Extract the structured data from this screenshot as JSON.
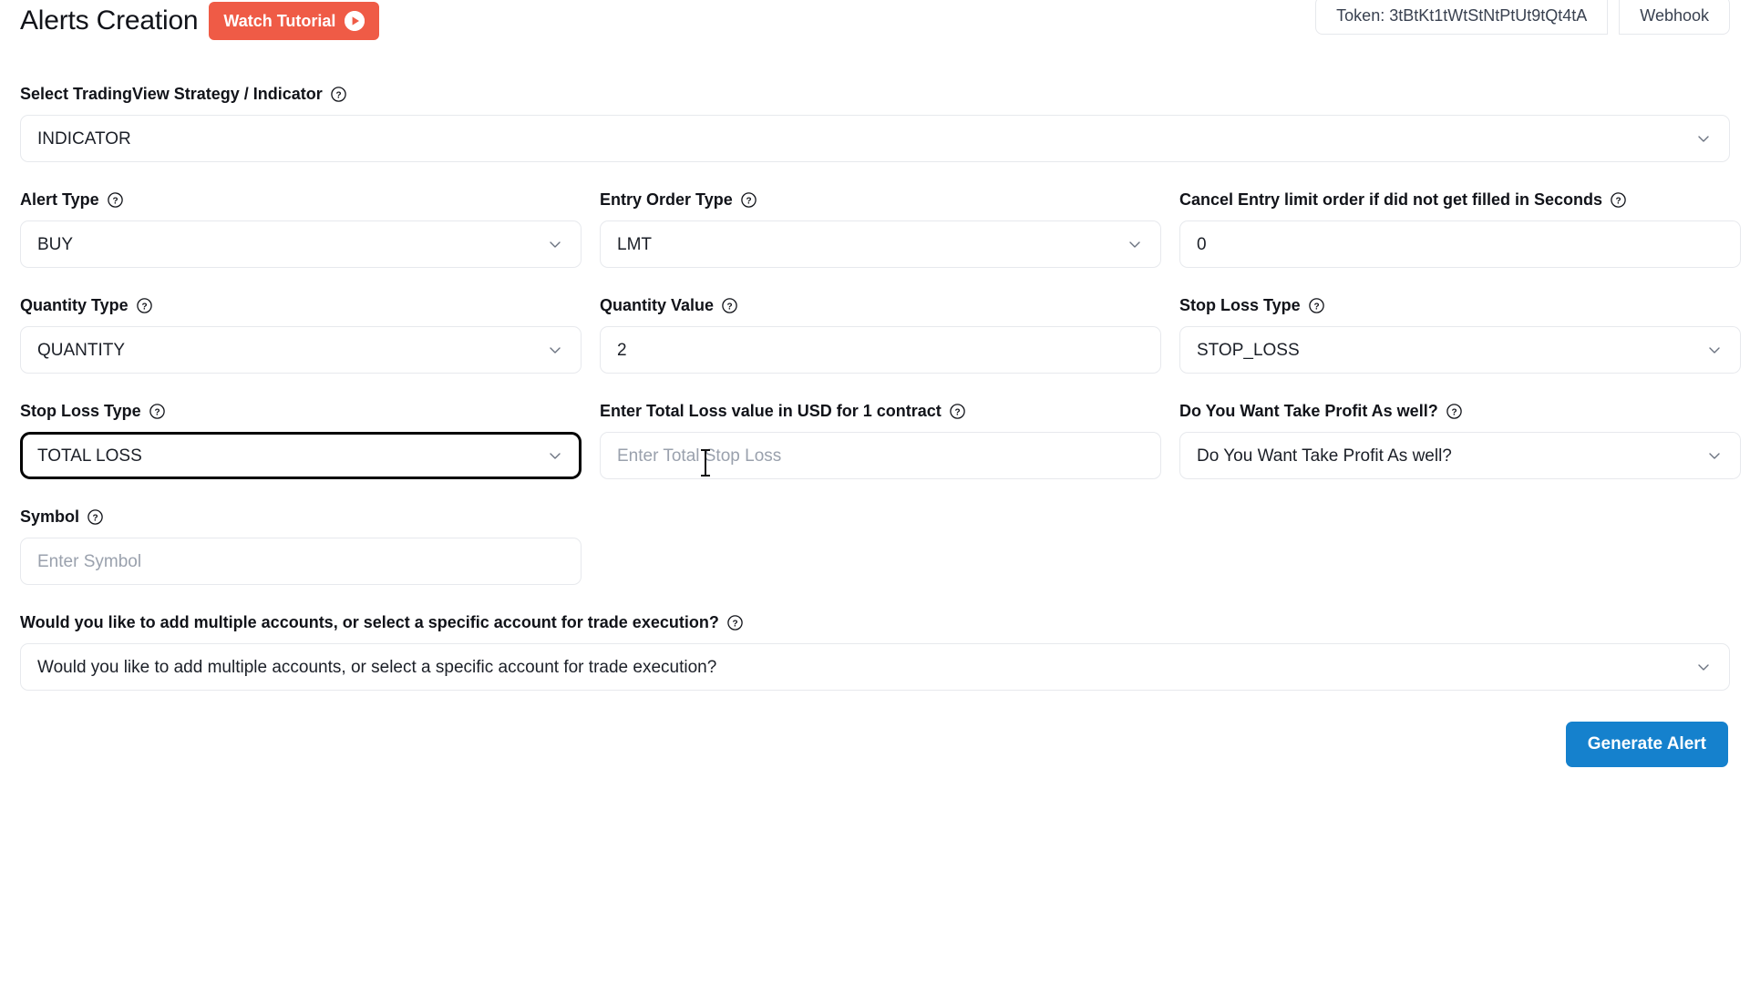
{
  "header": {
    "title": "Alerts Creation",
    "watch_tutorial_label": "Watch Tutorial",
    "token_label": "Token: 3tBtKt1tWtStNtPtUt9tQt4tA",
    "webhook_label": "Webhook"
  },
  "form": {
    "strategy": {
      "label": "Select TradingView Strategy / Indicator",
      "value": "INDICATOR"
    },
    "alert_type": {
      "label": "Alert Type",
      "value": "BUY"
    },
    "entry_order_type": {
      "label": "Entry Order Type",
      "value": "LMT"
    },
    "cancel_entry": {
      "label": "Cancel Entry limit order if did not get filled in Seconds",
      "value": "0"
    },
    "quantity_type": {
      "label": "Quantity Type",
      "value": "QUANTITY"
    },
    "quantity_value": {
      "label": "Quantity Value",
      "value": "2"
    },
    "stop_loss_type": {
      "label": "Stop Loss Type",
      "value": "STOP_LOSS"
    },
    "stop_loss_type_2": {
      "label": "Stop Loss Type",
      "value": "TOTAL LOSS"
    },
    "total_loss_value": {
      "label": "Enter Total Loss value in USD for 1 contract",
      "placeholder": "Enter Total Stop Loss"
    },
    "take_profit": {
      "label": "Do You Want Take Profit As well?",
      "placeholder": "Do You Want Take Profit As well?"
    },
    "symbol": {
      "label": "Symbol",
      "placeholder": "Enter Symbol"
    },
    "accounts": {
      "label": "Would you like to add multiple accounts, or select a specific account for trade execution?",
      "placeholder": "Would you like to add multiple accounts, or select a specific account for trade execution?"
    }
  },
  "footer": {
    "generate_label": "Generate Alert"
  },
  "colors": {
    "accent_red": "#ef5b46",
    "accent_blue": "#1581cd",
    "focus_border": "#000000",
    "border": "#e7e9ed",
    "placeholder": "#9aa1ad"
  }
}
